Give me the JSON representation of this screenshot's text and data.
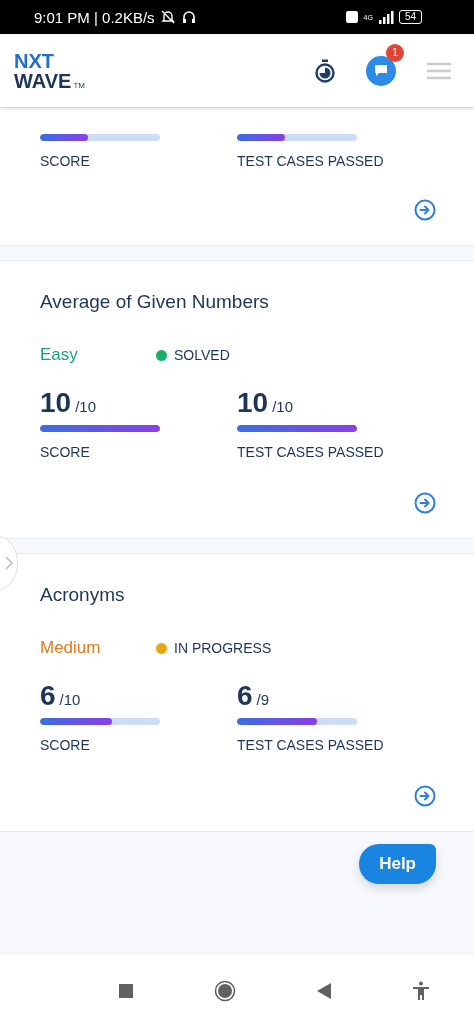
{
  "status_bar": {
    "time": "9:01 PM | 0.2KB/s",
    "network": "4G",
    "battery": "54"
  },
  "header": {
    "logo_top": "NXT",
    "logo_bottom": "WAVE",
    "trademark": "TM",
    "chat_badge": "1"
  },
  "first_card": {
    "metrics": [
      {
        "label": "SCORE",
        "level": 0.4
      },
      {
        "label": "TEST CASES PASSED",
        "level": 0.4
      }
    ]
  },
  "problems": [
    {
      "title": "Average of Given Numbers",
      "difficulty": {
        "label": "Easy",
        "color": "#1aa36f"
      },
      "status": "SOLVED",
      "color": "#17b26a",
      "metrics": [
        {
          "value": "10",
          "total": "/10",
          "label": "SCORE",
          "level": 1
        },
        {
          "value": "10",
          "total": "/10",
          "label": "TEST CASES PASSED",
          "level": 1
        }
      ]
    },
    {
      "title": "Acronyms",
      "difficulty": {
        "label": "Medium",
        "color": "#e07a1a"
      },
      "status": "IN PROGRESS",
      "color": "#e6a817",
      "metrics": [
        {
          "value": "6",
          "total": "/10",
          "label": "SCORE",
          "level": 0.6
        },
        {
          "value": "6",
          "total": "/9",
          "label": "TEST CASES PASSED",
          "level": 0.67
        }
      ]
    }
  ],
  "help_button": "Help"
}
